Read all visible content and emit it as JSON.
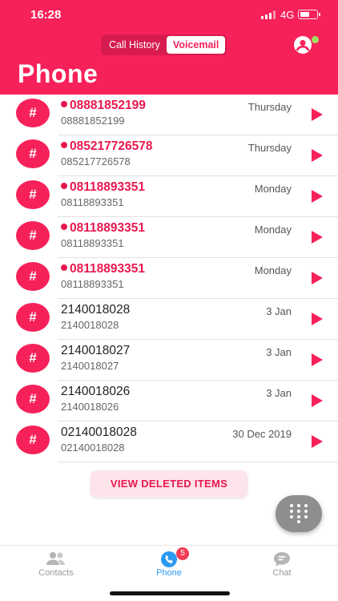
{
  "status_bar": {
    "time": "16:28",
    "network": "4G"
  },
  "header": {
    "tabs": [
      {
        "label": "Call History",
        "active": false
      },
      {
        "label": "Voicemail",
        "active": true
      }
    ],
    "title": "Phone",
    "accent_color": "#f7215a",
    "profile_icon": "profile-icon"
  },
  "voicemails": [
    {
      "avatar": "#",
      "number": "08881852199",
      "subtitle": "08881852199",
      "date": "Thursday",
      "unheard": true
    },
    {
      "avatar": "#",
      "number": "085217726578",
      "subtitle": "085217726578",
      "date": "Thursday",
      "unheard": true
    },
    {
      "avatar": "#",
      "number": "08118893351",
      "subtitle": "08118893351",
      "date": "Monday",
      "unheard": true
    },
    {
      "avatar": "#",
      "number": "08118893351",
      "subtitle": "08118893351",
      "date": "Monday",
      "unheard": true
    },
    {
      "avatar": "#",
      "number": "08118893351",
      "subtitle": "08118893351",
      "date": "Monday",
      "unheard": true
    },
    {
      "avatar": "#",
      "number": "2140018028",
      "subtitle": "2140018028",
      "date": "3 Jan",
      "unheard": false
    },
    {
      "avatar": "#",
      "number": "2140018027",
      "subtitle": "2140018027",
      "date": "3 Jan",
      "unheard": false
    },
    {
      "avatar": "#",
      "number": "2140018026",
      "subtitle": "2140018026",
      "date": "3 Jan",
      "unheard": false
    },
    {
      "avatar": "#",
      "number": "02140018028",
      "subtitle": "02140018028",
      "date": "30 Dec 2019",
      "unheard": false
    }
  ],
  "view_deleted_label": "VIEW DELETED ITEMS",
  "tabbar": {
    "contacts": "Contacts",
    "phone": "Phone",
    "chat": "Chat",
    "phone_badge": "5",
    "active_color": "#2b9af3"
  }
}
